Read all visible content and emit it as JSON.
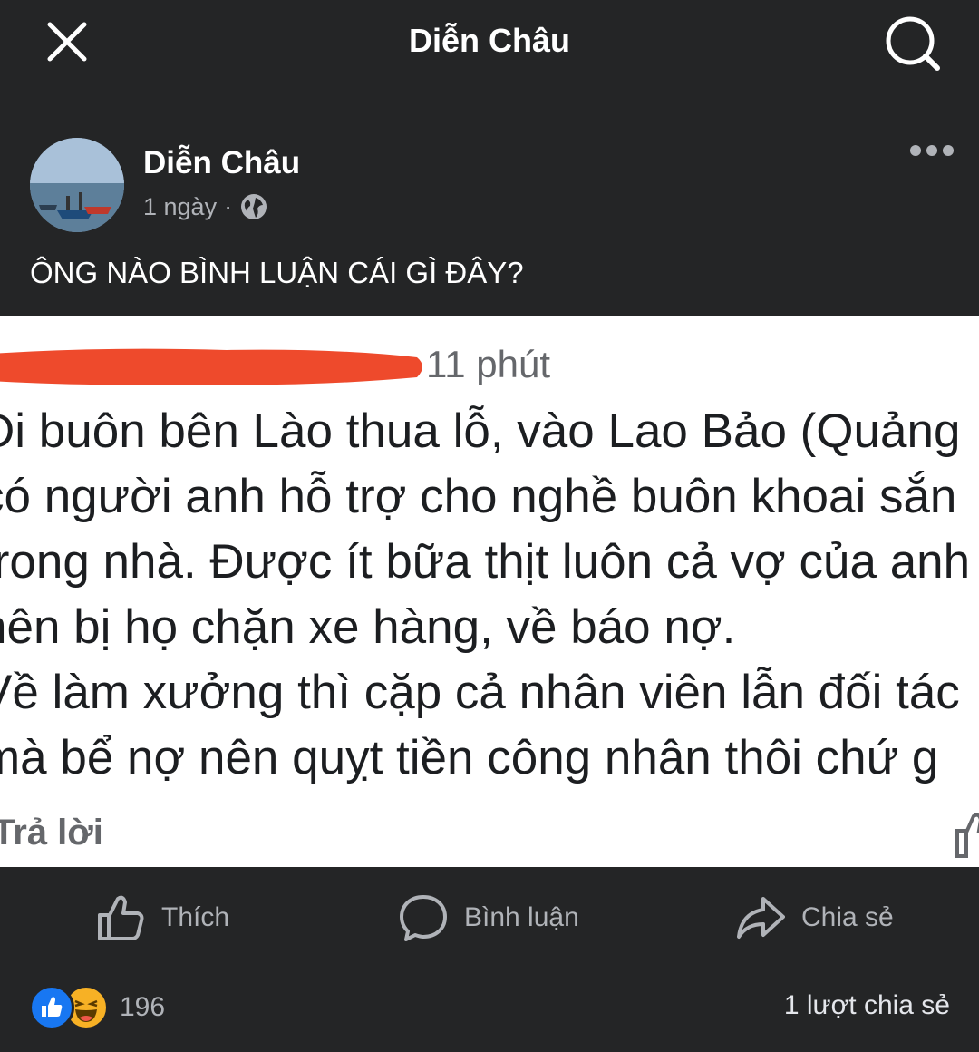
{
  "topbar": {
    "title": "Diễn Châu",
    "close_icon": "close-icon",
    "search_icon": "search-icon"
  },
  "post": {
    "author": "Diễn Châu",
    "time": "1 ngày",
    "separator": "·",
    "privacy_icon": "globe-icon",
    "caption": "ÔNG NÀO BÌNH LUẬN CÁI GÌ ĐÂY?",
    "more_icon": "more-horizontal-icon"
  },
  "embedded_comment": {
    "time": "11 phút",
    "lines": [
      "Đi buôn bên Lào thua lỗ, vào Lao Bảo (Quảng",
      "có người anh hỗ trợ cho nghề buôn khoai sắn",
      "trong nhà. Được ít bữa thịt luôn cả vợ của anh",
      "nên bị họ chặn xe hàng, về báo nợ.",
      "Về làm xưởng thì cặp cả nhân viên lẫn đối tác",
      "mà bể nợ nên quỵt tiền công nhân thôi chứ g"
    ],
    "reply_label": "Trả lời",
    "redaction_color": "#ee4a2c"
  },
  "actions": {
    "like_label": "Thích",
    "comment_label": "Bình luận",
    "share_label": "Chia sẻ"
  },
  "stats": {
    "reaction_count": "196",
    "shares": "1 lượt chia sẻ"
  },
  "colors": {
    "background": "#242526",
    "like_blue": "#1877f2",
    "haha_yellow": "#f7b125"
  }
}
